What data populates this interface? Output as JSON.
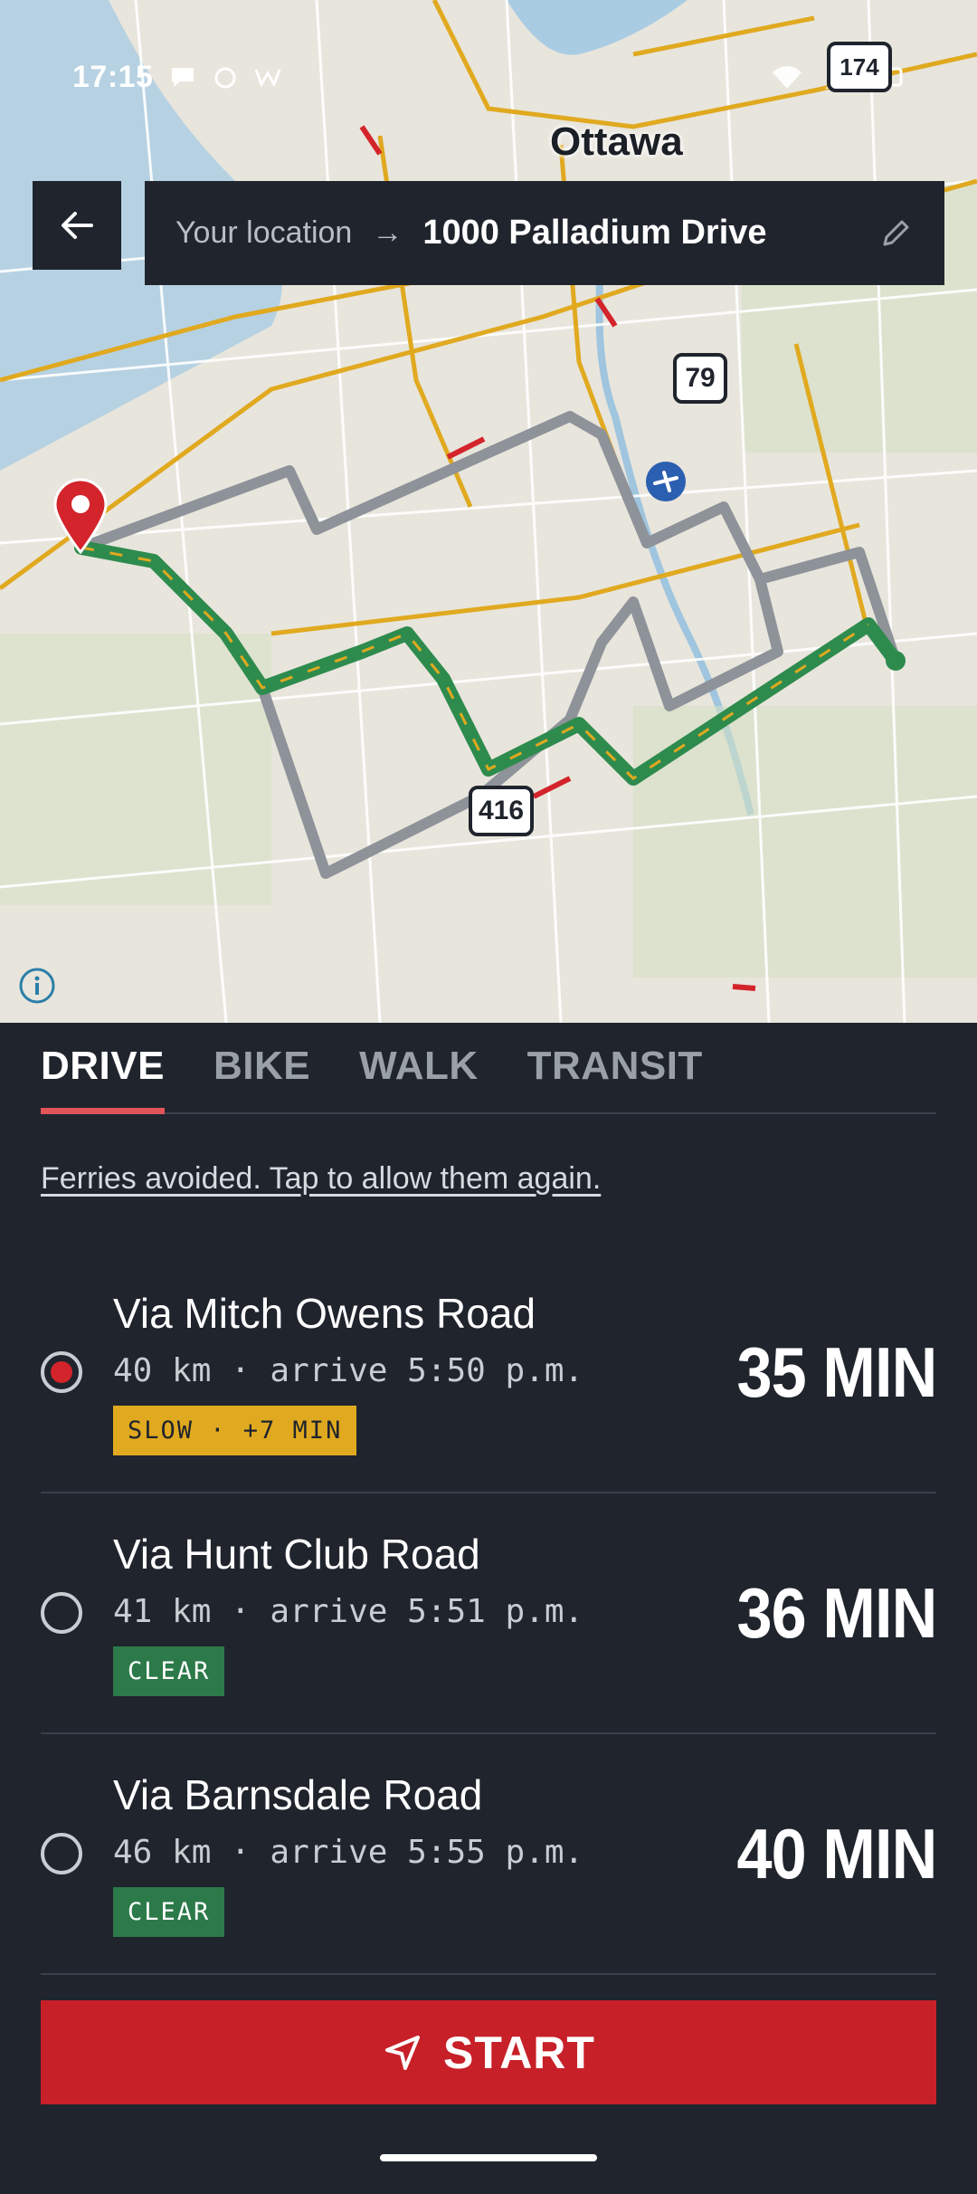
{
  "status_bar": {
    "time": "17:15"
  },
  "map": {
    "city_label": "Ottawa",
    "highway_shields": [
      "79",
      "416",
      "174"
    ],
    "colors": {
      "selected_route": "#2e8b4e",
      "alt_route": "#8e9299",
      "traffic_slow": "#e0a91f",
      "traffic_heavy": "#d3242b"
    }
  },
  "header": {
    "back_icon": "arrow-left-icon",
    "from": "Your location",
    "to": "1000 Palladium Drive",
    "edit_icon": "pencil-icon"
  },
  "tabs": [
    {
      "label": "DRIVE",
      "active": true
    },
    {
      "label": "BIKE",
      "active": false
    },
    {
      "label": "WALK",
      "active": false
    },
    {
      "label": "TRANSIT",
      "active": false
    }
  ],
  "notice": "Ferries avoided. Tap to allow them again.",
  "routes": [
    {
      "name": "Via Mitch Owens Road",
      "distance": "40 km",
      "arrive": "arrive 5:50 p.m.",
      "badge": "SLOW · +7 MIN",
      "status": "slow",
      "duration": "35 MIN",
      "selected": true
    },
    {
      "name": "Via Hunt Club Road",
      "distance": "41 km",
      "arrive": "arrive 5:51 p.m.",
      "badge": "CLEAR",
      "status": "clear",
      "duration": "36 MIN",
      "selected": false
    },
    {
      "name": "Via Barnsdale Road",
      "distance": "46 km",
      "arrive": "arrive 5:55 p.m.",
      "badge": "CLEAR",
      "status": "clear",
      "duration": "40 MIN",
      "selected": false
    }
  ],
  "start_button": {
    "label": "START",
    "icon": "navigation-arrow-icon"
  }
}
